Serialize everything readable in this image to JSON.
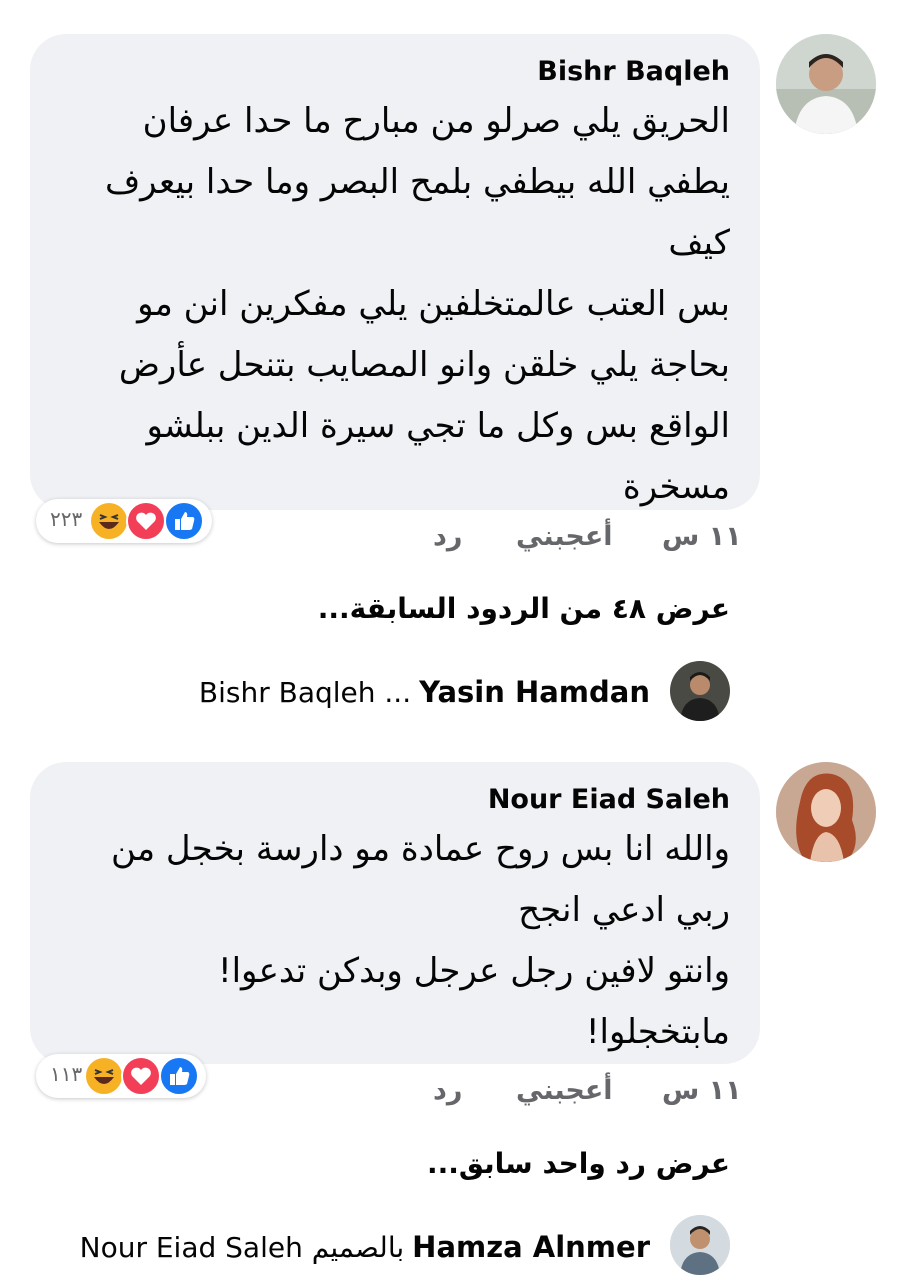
{
  "comments": [
    {
      "author": "Bishr Baqleh",
      "text": "الحريق يلي صرلو من مبارح ما حدا عرفان\nيطفي الله بيطفي بلمح البصر وما حدا بيعرف\nكيف\nبس العتب عالمتخلفين يلي مفكرين انن مو\nبحاجة يلي خلقن وانو المصايب بتنحل عأرض\nالواقع بس وكل ما تجي سيرة الدين ببلشو\nمسخرة",
      "time": "١١ س",
      "like": "أعجبني",
      "reply": "رد",
      "reaction_count": "٢٢٣",
      "reactions": [
        "like-icon",
        "love-icon",
        "haha-icon"
      ],
      "view_more": "عرض ٤٨ من الردود السابقة...",
      "latest_reply": {
        "author": "Yasin Hamdan",
        "text": "Bishr Baqleh ..."
      }
    },
    {
      "author": "Nour Eiad Saleh",
      "text": "والله انا بس روح عمادة مو دارسة بخجل من\nربي ادعي انجح\nوانتو لافين رجل عرجل وبدكن تدعوا!\nمابتخجلوا!",
      "time": "١١ س",
      "like": "أعجبني",
      "reply": "رد",
      "reaction_count": "١١٣",
      "reactions": [
        "like-icon",
        "love-icon",
        "haha-icon"
      ],
      "view_more": "عرض رد واحد سابق...",
      "latest_reply": {
        "author": "Hamza Alnmer",
        "text": "Nour Eiad Saleh بالصميم"
      }
    }
  ],
  "colors": {
    "bubble": "#eff1f4",
    "meta": "#65676b",
    "like": "#1877f2",
    "love": "#f33e58",
    "haha": "#f7b125"
  }
}
